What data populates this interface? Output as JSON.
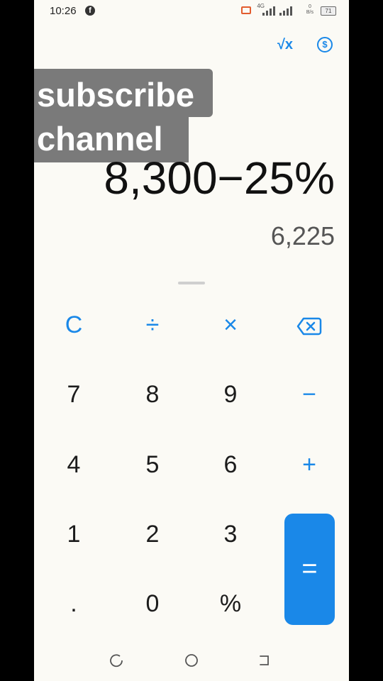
{
  "status": {
    "time": "10:26",
    "app_icon": "facebook-icon",
    "network_label": "4G",
    "net_speed_value": "0",
    "net_speed_unit": "B/s",
    "battery": "71"
  },
  "toolbar": {
    "sqrt_icon": "square-root-icon",
    "sqrt_symbol": "√x",
    "currency_icon": "currency-convert-icon",
    "currency_symbol": "$"
  },
  "overlay": {
    "line1": "subscribe",
    "line2": "channel"
  },
  "display": {
    "expression": "8,300−25%",
    "result": "6,225"
  },
  "keys": {
    "clear": "C",
    "divide": "÷",
    "multiply": "×",
    "backspace_icon": "backspace-icon",
    "seven": "7",
    "eight": "8",
    "nine": "9",
    "minus": "−",
    "four": "4",
    "five": "5",
    "six": "6",
    "plus": "+",
    "one": "1",
    "two": "2",
    "three": "3",
    "equals": "=",
    "dot": ".",
    "zero": "0",
    "percent": "%"
  },
  "navbar": {
    "recent_icon": "recent-apps-icon",
    "home_icon": "home-icon",
    "back_icon": "back-icon"
  },
  "colors": {
    "accent": "#1a88e8",
    "background": "#fbfaf5"
  }
}
